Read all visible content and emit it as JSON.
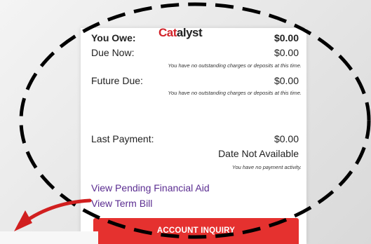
{
  "brand": {
    "part1": "Cat",
    "part2": "alyst"
  },
  "summary": {
    "you_owe_label": "You Owe:",
    "you_owe_value": "$0.00",
    "due_now_label": "Due Now:",
    "due_now_value": "$0.00",
    "due_now_note": "You have no outstanding charges or deposits at this time.",
    "future_due_label": "Future Due:",
    "future_due_value": "$0.00",
    "future_due_note": "You have no outstanding charges or deposits at this time.",
    "last_payment_label": "Last Payment:",
    "last_payment_value": "$0.00",
    "last_payment_date": "Date Not Available",
    "last_payment_note": "You have no payment activity."
  },
  "links": {
    "pending_aid": "View Pending Financial Aid",
    "term_bill": "View Term Bill"
  },
  "buttons": {
    "account_inquiry": "ACCOUNT INQUIRY"
  },
  "colors": {
    "accent_red": "#e5312f",
    "link_purple": "#5b2d91",
    "annotation_red": "#d11f1f"
  },
  "annotations": {
    "highlight": "dashed-ellipse",
    "pointer": "curved-arrow-left"
  }
}
